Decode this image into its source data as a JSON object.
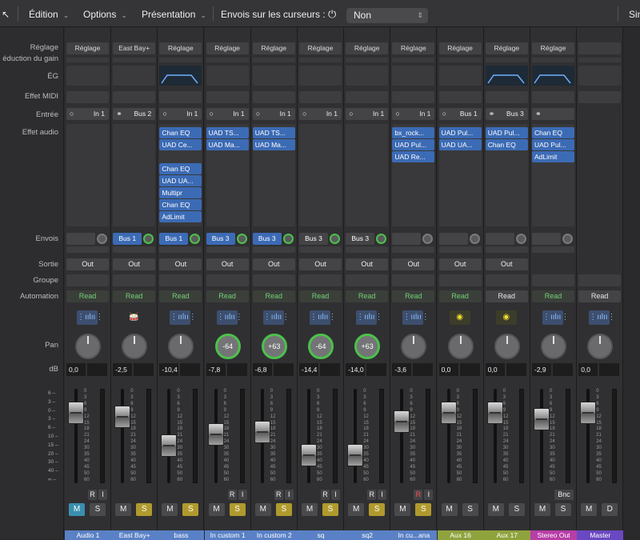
{
  "toolbar": {
    "edition": "Édition",
    "options": "Options",
    "presentation": "Présentation",
    "sends_label": "Envois sur les curseurs :",
    "sends_value": "Non",
    "right_cut": "Sin"
  },
  "row_labels": {
    "setting": "Réglage",
    "gain_reduction": "éduction du gain",
    "eq": "ÉG",
    "midi_fx": "Effet MIDI",
    "input": "Entrée",
    "audio_fx": "Effet audio",
    "sends": "Envois",
    "output": "Sortie",
    "group": "Groupe",
    "automation": "Automation",
    "pan": "Pan",
    "db": "dB"
  },
  "left_scale": [
    "6",
    "3",
    "0",
    "3",
    "6",
    "10",
    "15",
    "20",
    "30",
    "40",
    "∞"
  ],
  "fader_scale": [
    "0",
    "3",
    "6",
    "9",
    "12",
    "15",
    "18",
    "21",
    "24",
    "30",
    "35",
    "40",
    "45",
    "50",
    "60"
  ],
  "strips": [
    {
      "name": "Audio 1",
      "setting": "Réglage",
      "input": "In 1",
      "input_icon": "mono",
      "plugins": [],
      "send": "",
      "send_active": false,
      "output": "Out",
      "automation": "Read",
      "auto_white": false,
      "icon": "waveform",
      "pan": "",
      "pan_green": false,
      "db": "0,0",
      "fader_pct": 0.25,
      "m_on": true,
      "s_on": false,
      "name_color": "blue",
      "ri": "RI"
    },
    {
      "name": "East Bay+",
      "setting": "East Bay+",
      "input": "Bus 2",
      "input_icon": "stereo",
      "plugins": [],
      "send": "Bus 1",
      "send_active": true,
      "output": "Out",
      "automation": "Read",
      "auto_white": false,
      "icon": "drums",
      "pan": "",
      "pan_green": false,
      "db": "-2,5",
      "fader_pct": 0.3,
      "m_on": false,
      "s_on": true,
      "name_color": "blue",
      "ri": ""
    },
    {
      "name": "bass",
      "setting": "Réglage",
      "input": "In 1",
      "input_icon": "mono",
      "plugins": [
        "Chan EQ",
        "UAD Ce...",
        "",
        "Chan EQ",
        "UAD UA...",
        "Multipr",
        "Chan EQ",
        "AdLimit"
      ],
      "send": "Bus 1",
      "send_active": true,
      "output": "Out",
      "automation": "Read",
      "auto_white": false,
      "icon": "waveform",
      "pan": "",
      "pan_green": false,
      "db": "-10,4",
      "fader_pct": 0.6,
      "m_on": false,
      "s_on": true,
      "name_color": "blue",
      "ri": ""
    },
    {
      "name": "In custom 1",
      "setting": "Réglage",
      "input": "In 1",
      "input_icon": "mono",
      "plugins": [
        "UAD TS...",
        "UAD Ma..."
      ],
      "send": "Bus 3",
      "send_active": true,
      "output": "Out",
      "automation": "Read",
      "auto_white": false,
      "icon": "waveform",
      "pan": "-64",
      "pan_green": true,
      "db": "-7,8",
      "fader_pct": 0.48,
      "m_on": false,
      "s_on": true,
      "name_color": "blue",
      "ri": "RI"
    },
    {
      "name": "In custom 2",
      "setting": "Réglage",
      "input": "In 1",
      "input_icon": "mono",
      "plugins": [
        "UAD TS...",
        "UAD Ma..."
      ],
      "send": "Bus 3",
      "send_active": true,
      "output": "Out",
      "automation": "Read",
      "auto_white": false,
      "icon": "waveform",
      "pan": "+63",
      "pan_green": true,
      "db": "-6,8",
      "fader_pct": 0.46,
      "m_on": false,
      "s_on": true,
      "name_color": "blue",
      "ri": "RI"
    },
    {
      "name": "sq",
      "setting": "Réglage",
      "input": "In 1",
      "input_icon": "mono",
      "plugins": [],
      "send": "Bus 3",
      "send_active": false,
      "output": "Out",
      "automation": "Read",
      "auto_white": false,
      "icon": "waveform",
      "pan": "-64",
      "pan_green": true,
      "db": "-14,4",
      "fader_pct": 0.7,
      "m_on": false,
      "s_on": true,
      "name_color": "blue",
      "ri": "RI"
    },
    {
      "name": "sq2",
      "setting": "Réglage",
      "input": "In 1",
      "input_icon": "mono",
      "plugins": [],
      "send": "Bus 3",
      "send_active": false,
      "output": "Out",
      "automation": "Read",
      "auto_white": false,
      "icon": "waveform",
      "pan": "+63",
      "pan_green": true,
      "db": "-14,0",
      "fader_pct": 0.7,
      "m_on": false,
      "s_on": true,
      "name_color": "blue",
      "ri": "RI"
    },
    {
      "name": "In cu...ana",
      "setting": "Réglage",
      "input": "In 1",
      "input_icon": "mono",
      "plugins": [
        "bx_rock...",
        "UAD Pul...",
        "UAD Re..."
      ],
      "send": "",
      "send_active": false,
      "output": "Out",
      "automation": "Read",
      "auto_white": false,
      "icon": "waveform",
      "pan": "",
      "pan_green": false,
      "db": "-3,6",
      "fader_pct": 0.35,
      "m_on": false,
      "s_on": true,
      "name_color": "blue",
      "ri": "RI",
      "r_red": true
    },
    {
      "name": "Aux 16",
      "setting": "Réglage",
      "input": "Bus 1",
      "input_icon": "mono",
      "plugins": [
        "UAD Pul...",
        "UAD UA..."
      ],
      "send": "",
      "send_active": false,
      "output": "Out",
      "automation": "Read",
      "auto_white": false,
      "icon": "yellow",
      "pan": "",
      "pan_green": false,
      "db": "0,0",
      "fader_pct": 0.25,
      "m_on": false,
      "s_on": false,
      "name_color": "green",
      "ri": ""
    },
    {
      "name": "Aux 17",
      "setting": "Réglage",
      "input": "Bus 3",
      "input_icon": "stereo",
      "plugins": [
        "UAD Pul...",
        "Chan EQ"
      ],
      "send": "",
      "send_active": false,
      "output": "Out",
      "automation": "Read",
      "auto_white": true,
      "icon": "yellow",
      "pan": "",
      "pan_green": false,
      "db": "0,0",
      "fader_pct": 0.25,
      "m_on": false,
      "s_on": false,
      "name_color": "green",
      "ri": ""
    },
    {
      "name": "Stereo Out",
      "setting": "Réglage",
      "input": "",
      "input_icon": "stereo",
      "plugins": [
        "Chan EQ",
        "UAD Pul...",
        "AdLimit"
      ],
      "send": "",
      "send_active": false,
      "output": "",
      "automation": "Read",
      "auto_white": false,
      "icon": "waveform",
      "pan": "",
      "pan_green": false,
      "db": "-2,9",
      "fader_pct": 0.32,
      "m_on": false,
      "s_on": false,
      "name_color": "magenta",
      "ri": "Bnc"
    },
    {
      "name": "Master",
      "setting": "",
      "input": "",
      "input_icon": "",
      "plugins": [],
      "send": "",
      "send_active": false,
      "output": "",
      "automation": "Read",
      "auto_white": true,
      "icon": "waveform",
      "pan": "",
      "pan_green": false,
      "db": "0,0",
      "fader_pct": 0.25,
      "m_on": false,
      "s_on": false,
      "name_color": "purple",
      "ri": "",
      "ms": [
        "M",
        "D"
      ]
    }
  ]
}
